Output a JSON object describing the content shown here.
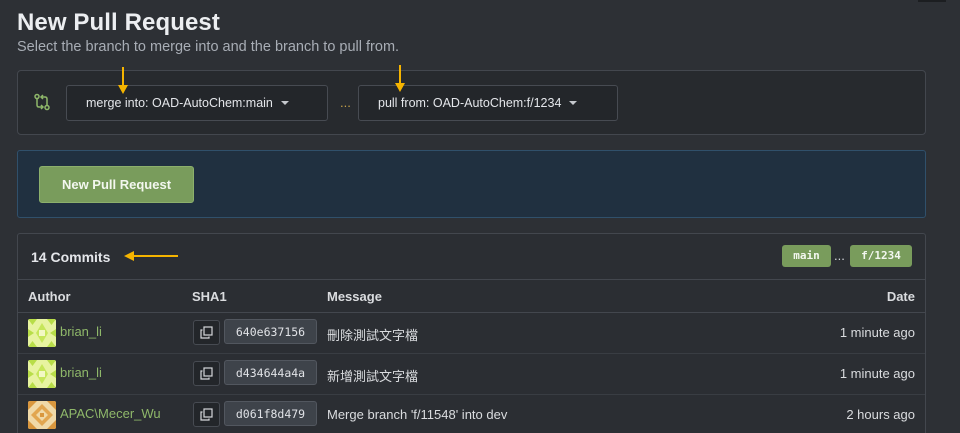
{
  "page": {
    "title": "New Pull Request",
    "subtitle": "Select the branch to merge into and the branch to pull from."
  },
  "branches": {
    "merge_into_label": "merge into: OAD-AutoChem:main",
    "separator": "...",
    "pull_from_label": "pull from: OAD-AutoChem:f/1234"
  },
  "create": {
    "button_label": "New Pull Request"
  },
  "commits": {
    "count_label": "14 Commits",
    "base_tag": "main",
    "tag_separator": "...",
    "head_tag": "f/1234",
    "columns": {
      "author": "Author",
      "sha": "SHA1",
      "message": "Message",
      "date": "Date"
    },
    "rows": [
      {
        "author": "brian_li",
        "sha": "640e637156",
        "message": "刪除測試文字檔",
        "date": "1 minute ago"
      },
      {
        "author": "brian_li",
        "sha": "d434644a4a",
        "message": "新增測試文字檔",
        "date": "1 minute ago"
      },
      {
        "author": "APAC\\Mecer_Wu",
        "sha": "d061f8d479",
        "message": "Merge branch 'f/11548' into dev",
        "date": "2 hours ago"
      }
    ]
  },
  "colors": {
    "accent_green": "#799c5c",
    "annotation_arrow": "#f5b400",
    "author_link": "#8fb86a"
  }
}
